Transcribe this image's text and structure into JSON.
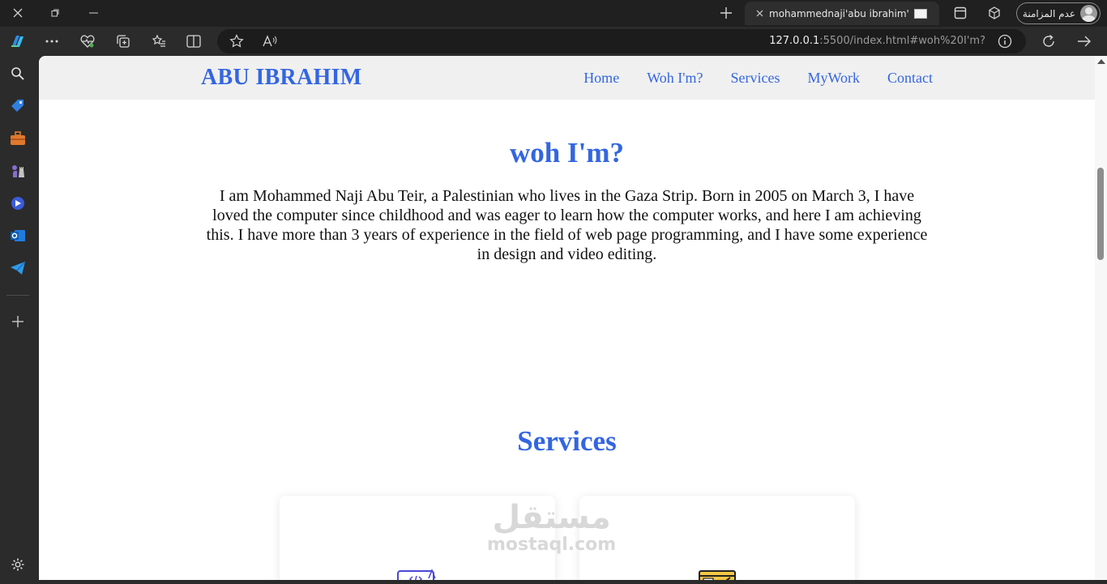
{
  "browser": {
    "tab_title": "mohammednaji'abu ibrahim'",
    "profile_name": "عدم المزامنة",
    "url_host": "127.0.0.1",
    "url_rest": ":5500/index.html#woh%20I'm?"
  },
  "site": {
    "logo": "ABU IBRAHIM",
    "nav": [
      "Home",
      "Woh I'm?",
      "Services",
      "MyWork",
      "Contact"
    ],
    "about_title": "woh I'm?",
    "about_text": "I am Mohammed Naji Abu Teir, a Palestinian who lives in the Gaza Strip. Born in 2005 on March 3, I have loved the computer since childhood and was eager to learn how the computer works, and here I am achieving this. I have more than 3 years of experience in the field of web page programming, and I have some experience in design and video editing.",
    "services_title": "Services"
  },
  "watermark": {
    "arabic": "مستقل",
    "latin": "mostaql.com"
  },
  "colors": {
    "accent": "#3366e0",
    "navbar_bg": "#f0f0f0",
    "chrome_dark": "#202020"
  }
}
